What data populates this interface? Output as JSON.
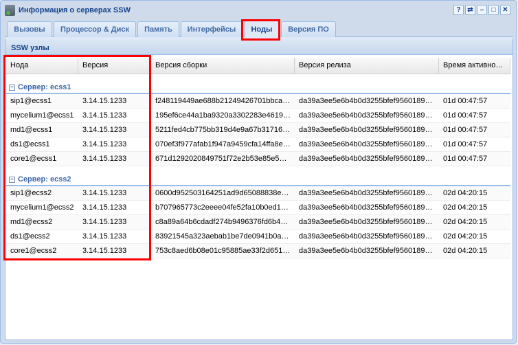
{
  "window": {
    "title": "Информация о серверах SSW",
    "tools": [
      "?",
      "⇄",
      "–",
      "□",
      "✕"
    ]
  },
  "tabs": [
    {
      "label": "Вызовы"
    },
    {
      "label": "Процессор & Диск"
    },
    {
      "label": "Память"
    },
    {
      "label": "Интерфейсы"
    },
    {
      "label": "Ноды",
      "active": true
    },
    {
      "label": "Версия ПО"
    }
  ],
  "panel": {
    "title": "SSW узлы"
  },
  "columns": [
    "Нода",
    "Версия",
    "Версия сборки",
    "Версия релиза",
    "Время активно…"
  ],
  "groups": [
    {
      "label": "Сервер: ecss1",
      "rows": [
        [
          "sip1@ecss1",
          "3.14.15.1233",
          "f248119449ae688b21249426701bbca…",
          "da39a3ee5e6b4b0d3255bfef9560189…",
          "01d 00:47:57"
        ],
        [
          "mycelium1@ecss1",
          "3.14.15.1233",
          "195ef6ce44a1ba9320a3302283e4619…",
          "da39a3ee5e6b4b0d3255bfef9560189…",
          "01d 00:47:57"
        ],
        [
          "md1@ecss1",
          "3.14.15.1233",
          "5211fed4cb775bb319d4e9a67b31716…",
          "da39a3ee5e6b4b0d3255bfef9560189…",
          "01d 00:47:57"
        ],
        [
          "ds1@ecss1",
          "3.14.15.1233",
          "070ef3f977afab1f947a9459cfa14ffa8e…",
          "da39a3ee5e6b4b0d3255bfef9560189…",
          "01d 00:47:57"
        ],
        [
          "core1@ecss1",
          "3.14.15.1233",
          "671d1292020849751f72e2b53e85e52…",
          "da39a3ee5e6b4b0d3255bfef9560189…",
          "01d 00:47:57"
        ]
      ]
    },
    {
      "label": "Сервер: ecss2",
      "rows": [
        [
          "sip1@ecss2",
          "3.14.15.1233",
          "0600d952503164251ad9d65088838e…",
          "da39a3ee5e6b4b0d3255bfef9560189…",
          "02d 04:20:15"
        ],
        [
          "mycelium1@ecss2",
          "3.14.15.1233",
          "b707965773c2eeee04fe52fa10b0ed1…",
          "da39a3ee5e6b4b0d3255bfef9560189…",
          "02d 04:20:15"
        ],
        [
          "md1@ecss2",
          "3.14.15.1233",
          "c8a89a64b6cdadf274b9496376fd6b4…",
          "da39a3ee5e6b4b0d3255bfef9560189…",
          "02d 04:20:15"
        ],
        [
          "ds1@ecss2",
          "3.14.15.1233",
          "83921545a323aebab1be7de0941b0a…",
          "da39a3ee5e6b4b0d3255bfef9560189…",
          "02d 04:20:15"
        ],
        [
          "core1@ecss2",
          "3.14.15.1233",
          "753c8aed6b08e01c95885ae33f2d651…",
          "da39a3ee5e6b4b0d3255bfef9560189…",
          "02d 04:20:15"
        ]
      ]
    }
  ],
  "colors": {
    "highlight": "#ff0000",
    "accent": "#15428b"
  }
}
